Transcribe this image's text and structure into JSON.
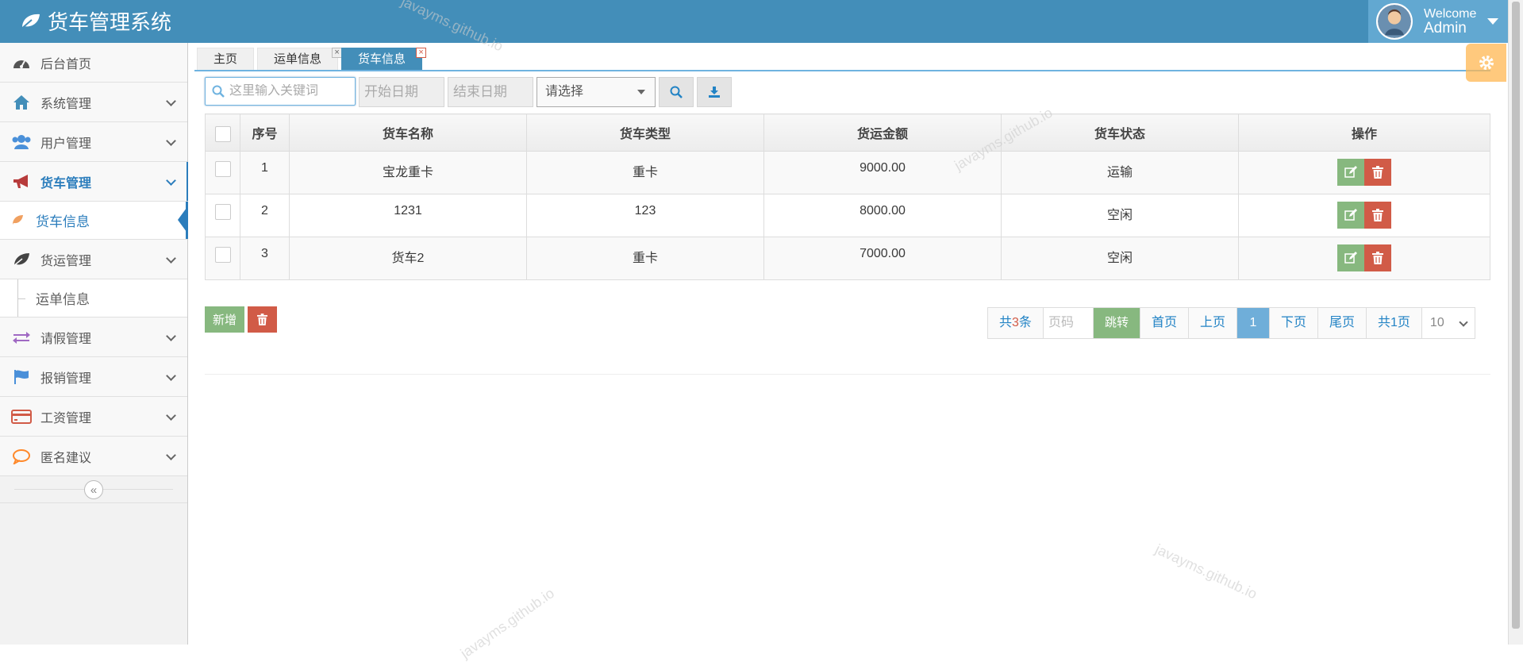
{
  "app": {
    "title": "货车管理系统"
  },
  "user": {
    "welcome": "Welcome",
    "name": "Admin"
  },
  "sidebar": {
    "items": [
      {
        "label": "后台首页",
        "icon": "dashboard-icon",
        "color": "#555555"
      },
      {
        "label": "系统管理",
        "icon": "home-icon",
        "color": "#438eb9"
      },
      {
        "label": "用户管理",
        "icon": "users-icon",
        "color": "#4a90d9"
      },
      {
        "label": "货车管理",
        "icon": "bullhorn-icon",
        "color": "#b73b3b"
      },
      {
        "label": "货车信息",
        "icon": "leaf-icon"
      },
      {
        "label": "货运管理",
        "icon": "leaf-icon",
        "color": "#444444"
      },
      {
        "label": "运单信息"
      },
      {
        "label": "请假管理",
        "icon": "exchange-icon",
        "color": "#a069c3"
      },
      {
        "label": "报销管理",
        "icon": "flag-icon",
        "color": "#4a90d9"
      },
      {
        "label": "工资管理",
        "icon": "credit-card-icon",
        "color": "#d15b47"
      },
      {
        "label": "匿名建议",
        "icon": "comment-icon",
        "color": "#ff892a"
      }
    ]
  },
  "tabs": [
    {
      "label": "主页"
    },
    {
      "label": "运单信息"
    },
    {
      "label": "货车信息"
    }
  ],
  "toolbar": {
    "search_placeholder": "这里输入关键词",
    "start_date": "开始日期",
    "end_date": "结束日期",
    "select_value": "请选择"
  },
  "table": {
    "headers": [
      "序号",
      "货车名称",
      "货车类型",
      "货运金额",
      "货车状态",
      "操作"
    ],
    "rows": [
      [
        "1",
        "宝龙重卡",
        "重卡",
        "9000.00",
        "运输"
      ],
      [
        "2",
        "1231",
        "123",
        "8000.00",
        "空闲"
      ],
      [
        "3",
        "货车2",
        "重卡",
        "7000.00",
        "空闲"
      ]
    ]
  },
  "actions": {
    "add_label": "新增"
  },
  "pager": {
    "total_prefix": "共",
    "total_count": "3",
    "total_suffix": "条",
    "page_input_placeholder": "页码",
    "jump": "跳转",
    "first": "首页",
    "prev": "上页",
    "current": "1",
    "next": "下页",
    "last": "尾页",
    "total_pages": "共1页",
    "page_size": "10"
  },
  "watermark": "javayms.github.io",
  "colors": {
    "primary": "#438eb9",
    "success": "#87b87f",
    "danger": "#d15b47",
    "warning": "#ffb752"
  }
}
